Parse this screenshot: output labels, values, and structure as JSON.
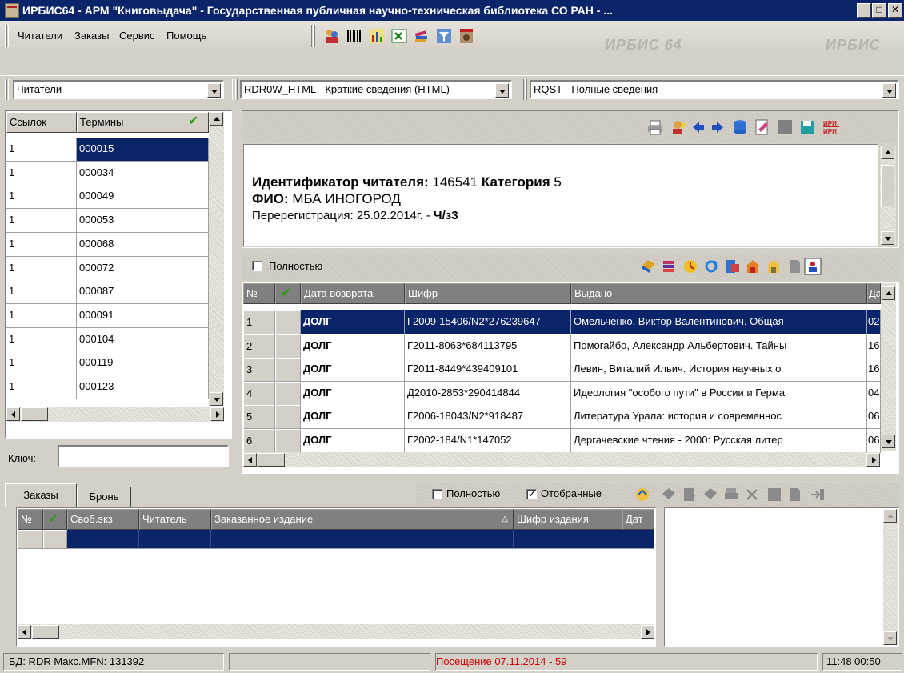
{
  "window": {
    "title": "ИРБИС64 - АРМ \"Книговыдача\" - Государственная публичная научно-техническая библиотека СО РАН - ...",
    "minimize": "_",
    "maximize": "□",
    "close": "✕"
  },
  "menu": {
    "items": [
      "Читатели",
      "Заказы",
      "Сервис",
      "Помощь"
    ]
  },
  "watermark": [
    "ИРБИС 64",
    "ИРБИС"
  ],
  "combos": {
    "database": "Читатели",
    "brief_format": "RDR0W_HTML - Краткие сведения (HTML)",
    "full_format": "RQST - Полные сведения"
  },
  "terms": {
    "col_links": "Ссылок",
    "col_terms": "Термины",
    "rows": [
      {
        "links": "1",
        "term": "000015"
      },
      {
        "links": "1",
        "term": "000034"
      },
      {
        "links": "1",
        "term": "000049"
      },
      {
        "links": "1",
        "term": "000053"
      },
      {
        "links": "1",
        "term": "000068"
      },
      {
        "links": "1",
        "term": "000072"
      },
      {
        "links": "1",
        "term": "000087"
      },
      {
        "links": "1",
        "term": "000091"
      },
      {
        "links": "1",
        "term": "000104"
      },
      {
        "links": "1",
        "term": "000119"
      },
      {
        "links": "1",
        "term": "000123"
      }
    ],
    "key_label": "Ключ:",
    "key_value": ""
  },
  "reader": {
    "id_label": "Идентификатор читателя:",
    "id_value": "146541",
    "category_label": "Категория",
    "category_value": "5",
    "fio_label": "ФИО:",
    "fio_value": "МБА ИНОГОРОД",
    "rereg_text": "Перерегистрация: 25.02.2014г. -",
    "rereg_place": "Ч/з3"
  },
  "loans": {
    "full_label": "Полностью",
    "col_num": "№",
    "col_return": "Дата возврата",
    "col_code": "Шифр",
    "col_issued": "Выдано",
    "col_date": "Да",
    "rows": [
      {
        "num": "1",
        "return": "ДОЛГ",
        "code": "Г2009-15406/N2*276239647",
        "issued": "Омельченко, Виктор Валентинович. Общая",
        "date": "02"
      },
      {
        "num": "2",
        "return": "ДОЛГ",
        "code": "Г2011-8063*684113795",
        "issued": "Помогайбо, Александр Альбертович. Тайны",
        "date": "16"
      },
      {
        "num": "3",
        "return": "ДОЛГ",
        "code": "Г2011-8449*439409101",
        "issued": "Левин, Виталий Ильич. История научных о",
        "date": "16"
      },
      {
        "num": "4",
        "return": "ДОЛГ",
        "code": "Д2010-2853*290414844",
        "issued": "Идеология \"особого пути\" в России и Герма",
        "date": "04"
      },
      {
        "num": "5",
        "return": "ДОЛГ",
        "code": "Г2006-18043/N2*918487",
        "issued": "Литература Урала: история и современнос",
        "date": "06"
      },
      {
        "num": "6",
        "return": "ДОЛГ",
        "code": "Г2002-184/N1*147052",
        "issued": "Дергачевские чтения - 2000: Русская литер",
        "date": "06"
      }
    ]
  },
  "orders": {
    "tab_orders": "Заказы",
    "tab_reserve": "Бронь",
    "full_label": "Полностью",
    "selected_label": "Отобранные",
    "col_num": "№",
    "col_free": "Своб.экз",
    "col_reader": "Читатель",
    "col_item": "Заказанное издание",
    "col_code": "Шифр издания",
    "col_date": "Дат"
  },
  "status": {
    "db": "БД: RDR Макс.MFN: 131392",
    "middle": "",
    "visit": "Посещение 07.11.2014 - 59",
    "time": "11:48  00:50",
    "visit_color": "#d00000"
  }
}
